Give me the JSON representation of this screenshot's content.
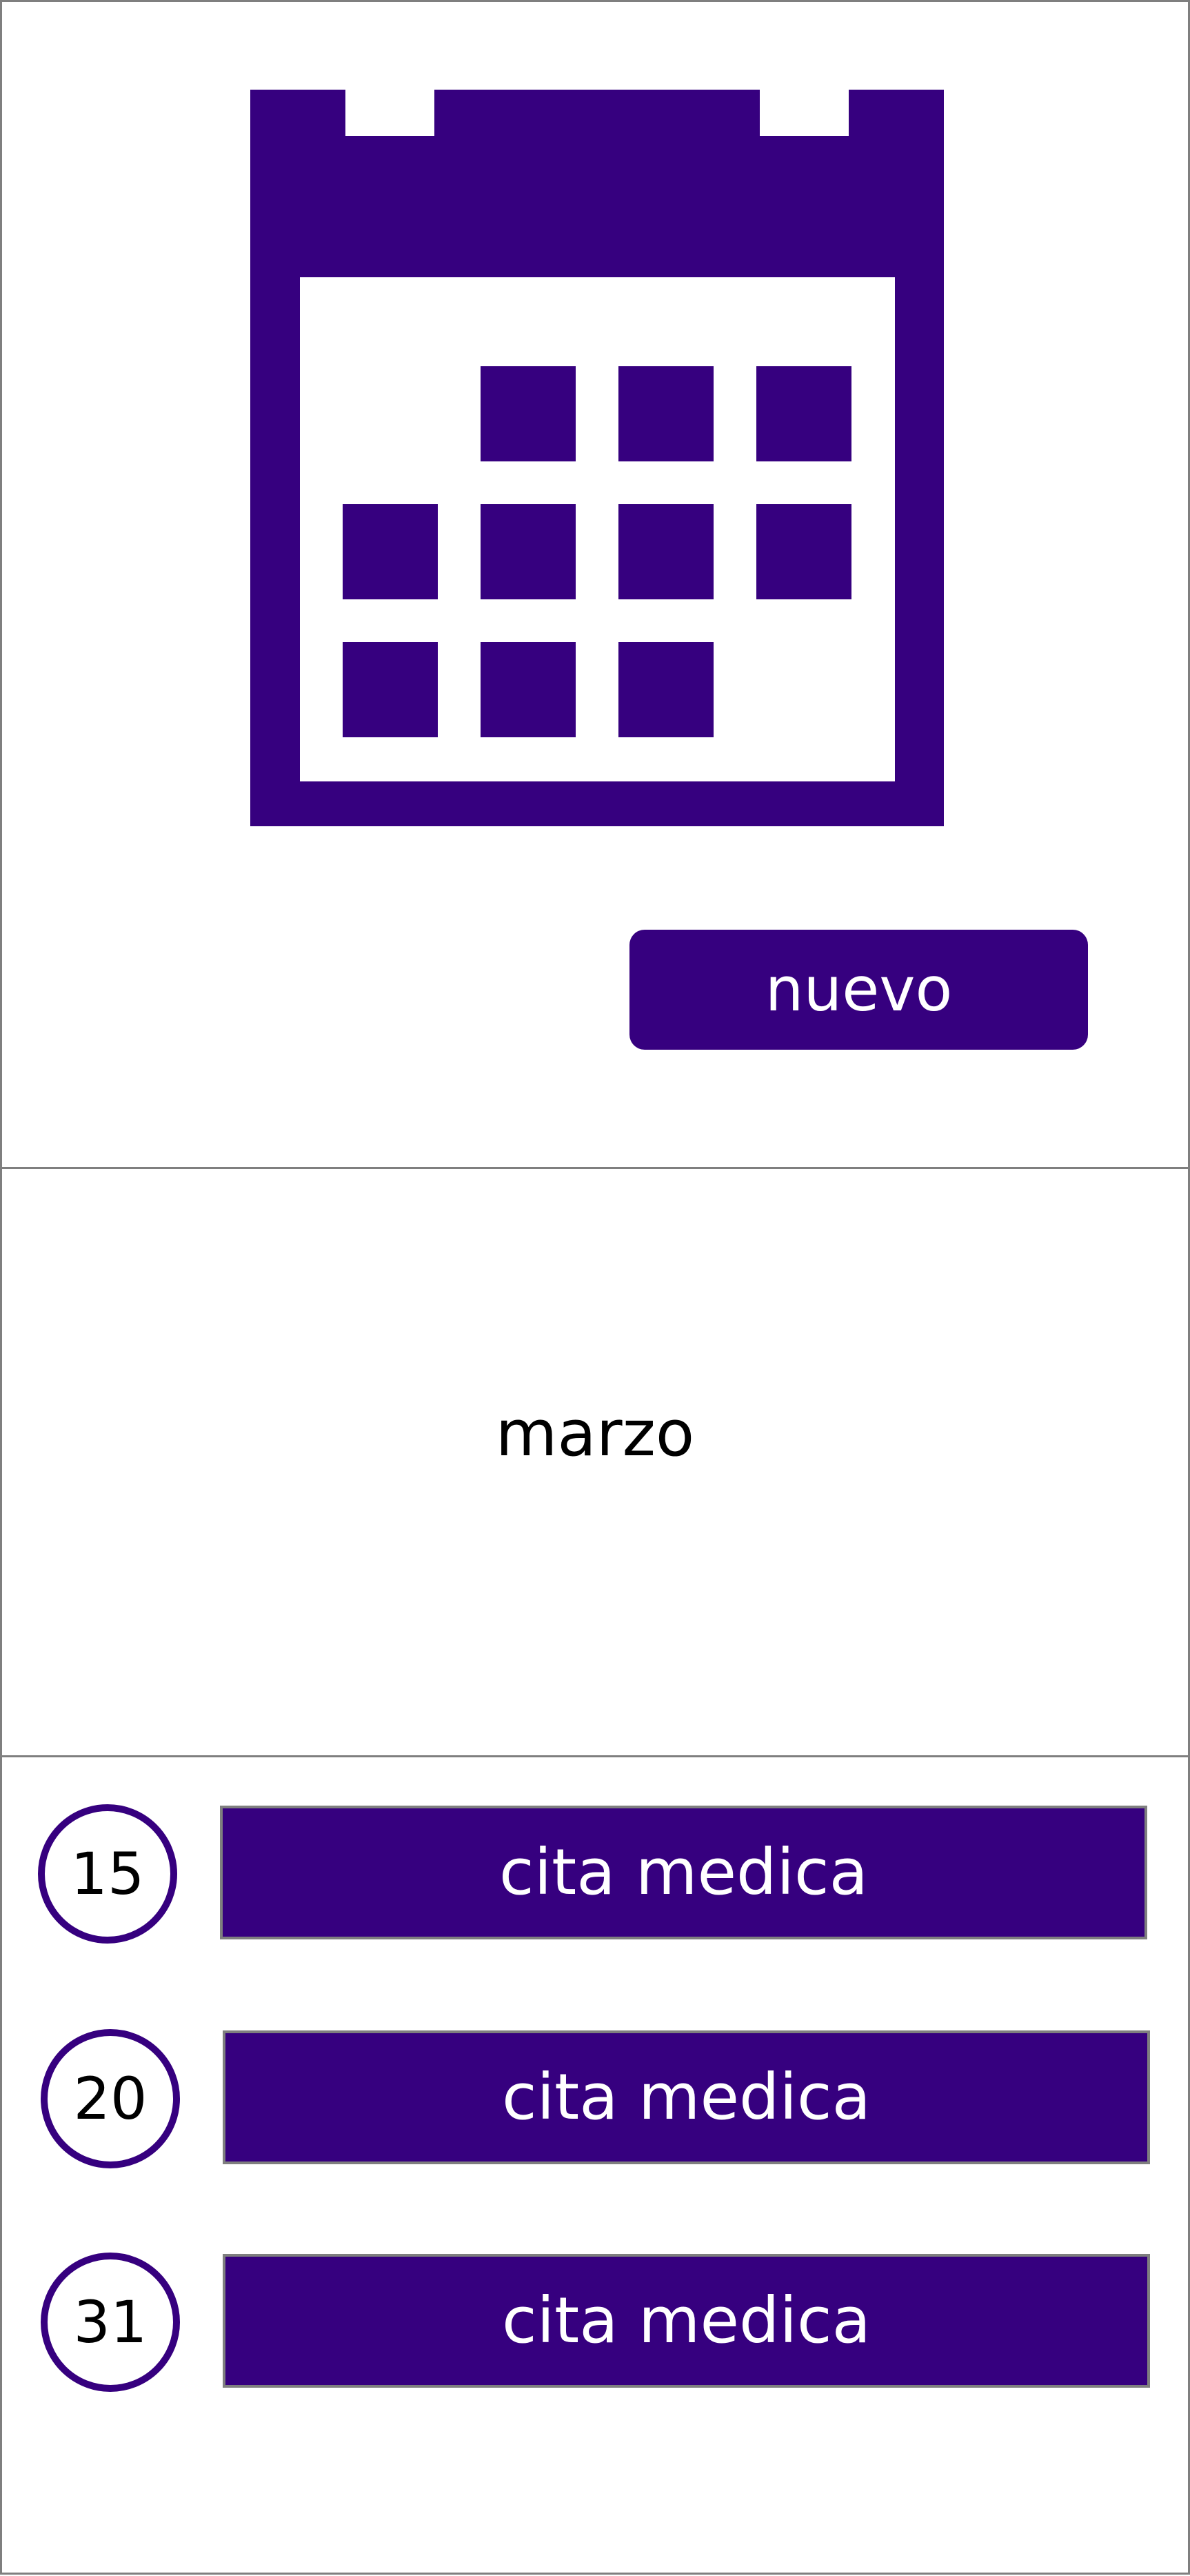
{
  "colors": {
    "accent": "#36007f",
    "border": "#7f7f7f",
    "background": "#ffffff"
  },
  "header": {
    "icon": "calendar-icon",
    "new_button_label": "nuevo"
  },
  "month": {
    "label": "marzo"
  },
  "appointments": [
    {
      "day": "15",
      "title": "cita medica"
    },
    {
      "day": "20",
      "title": "cita medica"
    },
    {
      "day": "31",
      "title": "cita medica"
    }
  ]
}
